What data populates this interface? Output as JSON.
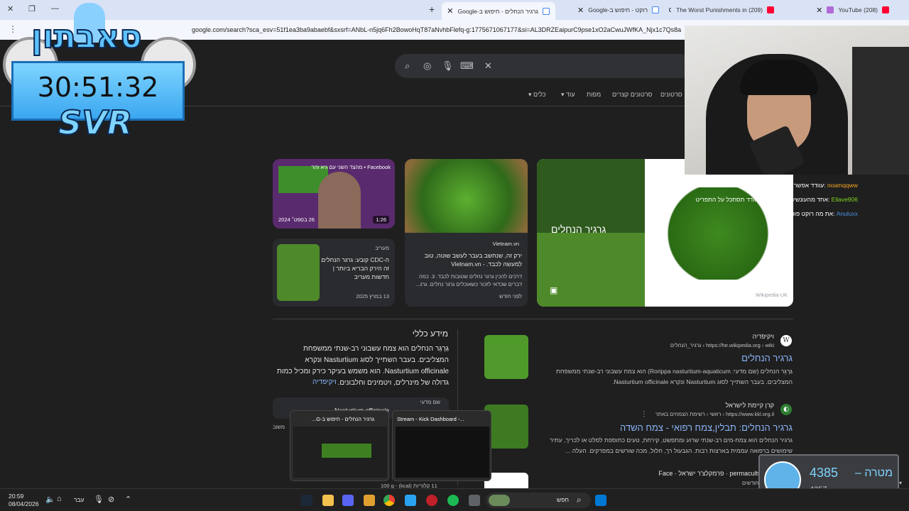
{
  "browser": {
    "tabs": [
      {
        "title": "גרגיר הנחלים - חיפוש ב-Google",
        "active": true
      },
      {
        "title": "רוקט - חיפוש ב-Google",
        "active": false
      },
      {
        "title": "(209) The Worst Punishments in",
        "active": false
      },
      {
        "title": "(208) YouTube",
        "active": false
      }
    ],
    "url": "google.com/search?sca_esv=51f1ea3ba9abaebf&sxsrf=ANbL-n5jq6Fh2BowoHqT87aNvhbFlefq-g:1775671067177&si=AL3DRZEaipurC9pse1xO2aCwuJWfKA_Njx1c7Qs8a"
  },
  "filters": [
    "סרטונים",
    "סרטונים קצרים",
    "מפות",
    "עוד",
    "כלים"
  ],
  "image_cards": {
    "facebook": {
      "source": "Facebook • מהצד השני עם גיא זהר",
      "duration": "1:26",
      "date": "26 בספט׳ 2024"
    },
    "vietnam": {
      "source": "Vietnam.vn",
      "title": "ירק זה, שנחשב בעבר לעשב שוטה, טוב למעשה לכבד. - Vietnam.vn",
      "snippet": "דרכים להכין גרגר נחלים שטובות לכבד. 3. כמה דברים שכדאי לזכור כשאוכלים גרגר נחלים. גרג...",
      "age": "לפני חודש"
    },
    "maariv": {
      "source": "מעריב",
      "title": "ה-CDC קובע: גרגר הנחלים זה הירק הבריא ביותר | חדשות מעריב",
      "date": "13 במרץ 2025"
    },
    "collage_label": "גרגיר הנחלים",
    "wiki_credit": "Wikipedia UK"
  },
  "knowledge_panel": {
    "heading": "מידע כללי",
    "text": "גַּרְגֵּר הנחלים הוא צמח עשבוני רב-שנתי ממשפחת המצליבים. בעבר השתייך לסוג Nasturtium ונקרא Nasturtium officinale. הוא משמש בעיקר כירק ומכיל כמות גדולה של מינרלים, ויטמינים וחלבונים.",
    "link": "ויקיפדיה",
    "chip_title": "Nasturtium officinale",
    "chip_sub": "שם מדעי",
    "extra": "משוב"
  },
  "results": [
    {
      "site": "ויקיפדיה",
      "url": "https://he.wikipedia.org › wiki › גרגיר_הנחלים",
      "title": "גרגיר הנחלים",
      "snippet": "גַּרְגֵּר הנחלים (שם מדעי: Rorippa nasturtium-aquaticum) הוא צמח עשבוני רב-שנתי ממשפחת המצליבים. בעבר השתייך לסוג Nasturtium ונקרא Nasturtium officinale."
    },
    {
      "site": "קרן קיימת לישראל",
      "url": "https://www.kkl.org.il › ראשי › רשימת הצמחים באתר",
      "title": "גרגיר הנחלים: תבלין,צמח רפואי - צמח השדה",
      "snippet": "גרגיר הנחלים הוא צמח-מים רב-שנתי שרוע ומתפשט, קירחת, טעים כתוספת לסלט או לכריך, עתיר שימושים ברפואה עממית בארצות רבות. הגבעול רך, חלול, מכה שורשים במפרקים. העלה ..."
    },
    {
      "site": "permaculture IL · פרמקלצ'ר ישראל · Face",
      "url": "לפני 5 חודשים",
      "title": "",
      "snippet": ""
    }
  ],
  "overlay": {
    "brand": "סאבתון",
    "timer": "30:51:32",
    "tag": "SVR",
    "chat": [
      {
        "user": "noamqqww",
        "msg": ":עוודד אפשר להמליץ על משחק?"
      },
      {
        "user": "Ellave906",
        "msg": ":אחד מהעונשים של השירייי עוודד תסתכל על התפריט"
      },
      {
        "user": "Anuluxx",
        "msg": ":את מה רוקט פוטו"
      }
    ],
    "goal_label": "מטרה –",
    "goal_value": "4385",
    "goal_current": "4357"
  },
  "taskbar_previews": [
    {
      "title": "גרגיר הנחלים - חיפוש ב-G..."
    },
    {
      "title": "Stream - Kick Dashboard -..."
    }
  ],
  "calorie_text": "11 קלוריות (kcal) - 100 g",
  "taskbar": {
    "time": "20:59",
    "date": "08/04/2026",
    "lang": "עבר",
    "search_placeholder": "חפש"
  }
}
